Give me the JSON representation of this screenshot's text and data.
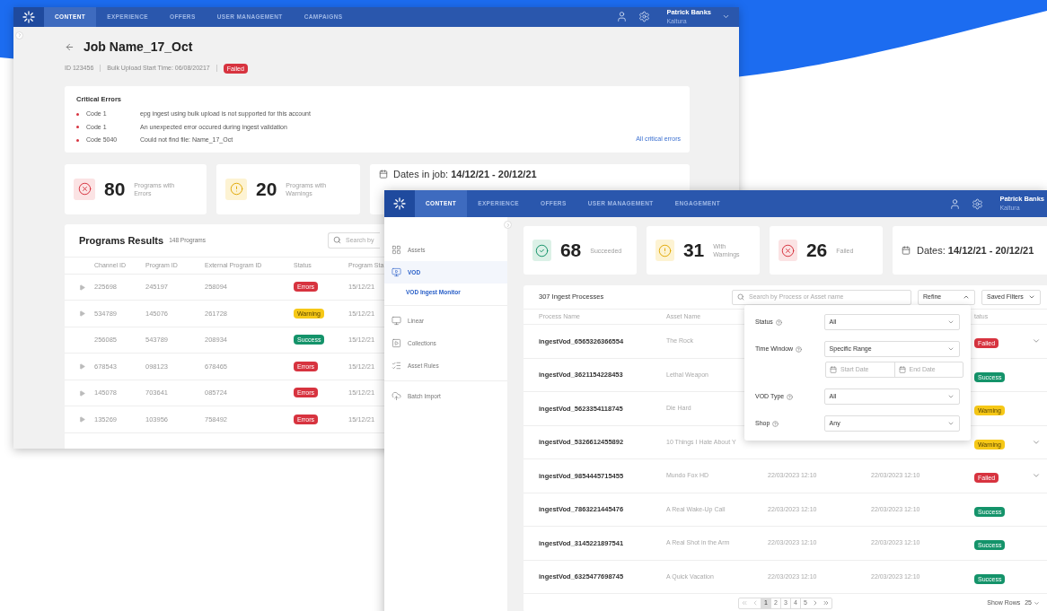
{
  "job_window": {
    "nav": {
      "tabs": [
        {
          "label": "CONTENT",
          "selected": true
        },
        {
          "label": "EXPERIENCE",
          "selected": false
        },
        {
          "label": "OFFERS",
          "selected": false
        },
        {
          "label": "USER MANAGEMENT",
          "selected": false
        },
        {
          "label": "CAMPAIGNS",
          "selected": false
        }
      ],
      "user": {
        "name": "Patrick Banks",
        "org": "Kaltura"
      }
    },
    "title": "Job Name_17_Oct",
    "meta": {
      "id": "ID 123456",
      "start_time": "Bulk Upload Start Time: 06/08/20217",
      "status": {
        "label": "Failed",
        "kind": "error"
      }
    },
    "critical_errors": {
      "title": "Critical Errors",
      "items": [
        {
          "code": "Code 1",
          "message": "epg ingest using bulk upload is not supported for this account"
        },
        {
          "code": "Code 1",
          "message": "An unexpected error occured during ingest validation"
        },
        {
          "code": "Code 5040",
          "message": "Could not find file: Name_17_Oct"
        }
      ],
      "link": "All critical errors"
    },
    "stats": [
      {
        "kind": "error",
        "value": "80",
        "label": "Programs with Errors"
      },
      {
        "kind": "warning",
        "value": "20",
        "label": "Programs with Warnings"
      }
    ],
    "dates": "Dates in job: **14/12/21 - 20/12/21**",
    "results": {
      "title": "Programs Results",
      "count": "148 Programs",
      "search_placeholder": "Search by",
      "columns": [
        "Channel ID",
        "Program ID",
        "External Program ID",
        "Status",
        "Program Sta"
      ],
      "rows": [
        {
          "expandable": true,
          "channel": "225698",
          "program": "245197",
          "external": "258094",
          "status": {
            "label": "Errors",
            "kind": "error"
          },
          "date": "15/12/21"
        },
        {
          "expandable": true,
          "channel": "534789",
          "program": "145076",
          "external": "261728",
          "status": {
            "label": "Warning",
            "kind": "warning"
          },
          "date": "15/12/21"
        },
        {
          "expandable": false,
          "channel": "256085",
          "program": "543789",
          "external": "208934",
          "status": {
            "label": "Success",
            "kind": "success"
          },
          "date": "15/12/21"
        },
        {
          "expandable": true,
          "channel": "678543",
          "program": "098123",
          "external": "678465",
          "status": {
            "label": "Errors",
            "kind": "error"
          },
          "date": "15/12/21"
        },
        {
          "expandable": true,
          "channel": "145078",
          "program": "703641",
          "external": "085724",
          "status": {
            "label": "Errors",
            "kind": "error"
          },
          "date": "15/12/21"
        },
        {
          "expandable": true,
          "channel": "135269",
          "program": "103956",
          "external": "758492",
          "status": {
            "label": "Errors",
            "kind": "error"
          },
          "date": "15/12/21"
        }
      ]
    }
  },
  "ingest_window": {
    "nav": {
      "tabs": [
        {
          "label": "CONTENT",
          "selected": true
        },
        {
          "label": "EXPERIENCE",
          "selected": false
        },
        {
          "label": "OFFERS",
          "selected": false
        },
        {
          "label": "USER MANAGEMENT",
          "selected": false
        },
        {
          "label": "ENGAGEMENT",
          "selected": false
        }
      ],
      "user": {
        "name": "Patrick Banks",
        "org": "Kaltura"
      }
    },
    "sidebar": {
      "groups": [
        {
          "items": [
            {
              "label": "Assets",
              "selected": false
            },
            {
              "label": "VOD",
              "selected": true,
              "children": [
                {
                  "label": "VOD Ingest Monitor",
                  "selected": true
                }
              ]
            }
          ]
        },
        {
          "items": [
            {
              "label": "Linear",
              "selected": false
            },
            {
              "label": "Collections",
              "selected": false
            },
            {
              "label": "Asset Rules",
              "selected": false
            }
          ]
        },
        {
          "items": [
            {
              "label": "Batch Import",
              "selected": false
            }
          ]
        }
      ]
    },
    "stats": [
      {
        "kind": "success",
        "value": "68",
        "label": "Succeeded"
      },
      {
        "kind": "warning",
        "value": "31",
        "label": "With Warnings"
      },
      {
        "kind": "error",
        "value": "26",
        "label": "Failed"
      }
    ],
    "dates": "Dates: **14/12/21 - 20/12/21**",
    "table": {
      "title": "307 Ingest Processes",
      "search_placeholder": "Search by Process or Asset name",
      "refine": "Refine",
      "saved_filters": "Saved Filters",
      "columns": [
        "Process Name",
        "Asset Name",
        "tatus"
      ],
      "rows": [
        {
          "process": "ingestVod_6565326366554",
          "asset": "The Rock",
          "status": {
            "label": "Failed",
            "kind": "error"
          },
          "expandable": true
        },
        {
          "process": "ingestVod_3621154228453",
          "asset": "Lethal Weapon",
          "status": {
            "label": "Success",
            "kind": "success"
          },
          "expandable": false
        },
        {
          "process": "ingestVod_5623354118745",
          "asset": "Die Hard",
          "status": {
            "label": "Warning",
            "kind": "warning"
          },
          "expandable": false
        },
        {
          "process": "ingestVod_5326612455892",
          "asset": "10 Things I Hate About Y",
          "status": {
            "label": "Warning",
            "kind": "warning"
          },
          "expandable": true
        },
        {
          "process": "ingestVod_9854445715455",
          "asset": "Mundo Fox HD",
          "start": "22/03/2023 12:10",
          "end": "22/03/2023 12:10",
          "status": {
            "label": "Failed",
            "kind": "error"
          },
          "expandable": true
        },
        {
          "process": "ingestVod_7863221445476",
          "asset": "A Real Wake-Up Call",
          "start": "22/03/2023 12:10",
          "end": "22/03/2023 12:10",
          "status": {
            "label": "Success",
            "kind": "success"
          },
          "expandable": false
        },
        {
          "process": "ingestVod_3145221897541",
          "asset": "A Real Shot in the Arm",
          "start": "22/03/2023 12:10",
          "end": "22/03/2023 12:10",
          "status": {
            "label": "Success",
            "kind": "success"
          },
          "expandable": false
        },
        {
          "process": "ingestVod_6325477698745",
          "asset": "A Quick Vacation",
          "start": "22/03/2023 12:10",
          "end": "22/03/2023 12:10",
          "status": {
            "label": "Success",
            "kind": "success"
          },
          "expandable": false
        }
      ],
      "pagination": {
        "pages": [
          {
            "label": "1",
            "selected": true
          },
          {
            "label": "2",
            "selected": false
          },
          {
            "label": "3",
            "selected": false
          },
          {
            "label": "4",
            "selected": false
          },
          {
            "label": "5",
            "selected": false
          }
        ],
        "show_rows_label": "Show Rows",
        "show_rows_value": "25"
      }
    },
    "refine_panel": {
      "fields": [
        {
          "kind": "select",
          "label": "Status",
          "value": "All"
        },
        {
          "kind": "select",
          "label": "Time Window",
          "value": "Specific Range"
        },
        {
          "kind": "date_range",
          "start_placeholder": "Start Date",
          "end_placeholder": "End Date"
        },
        {
          "kind": "select",
          "label": "VOD Type",
          "value": "All"
        },
        {
          "kind": "select",
          "label": "Shop",
          "value": "Any"
        }
      ]
    }
  }
}
